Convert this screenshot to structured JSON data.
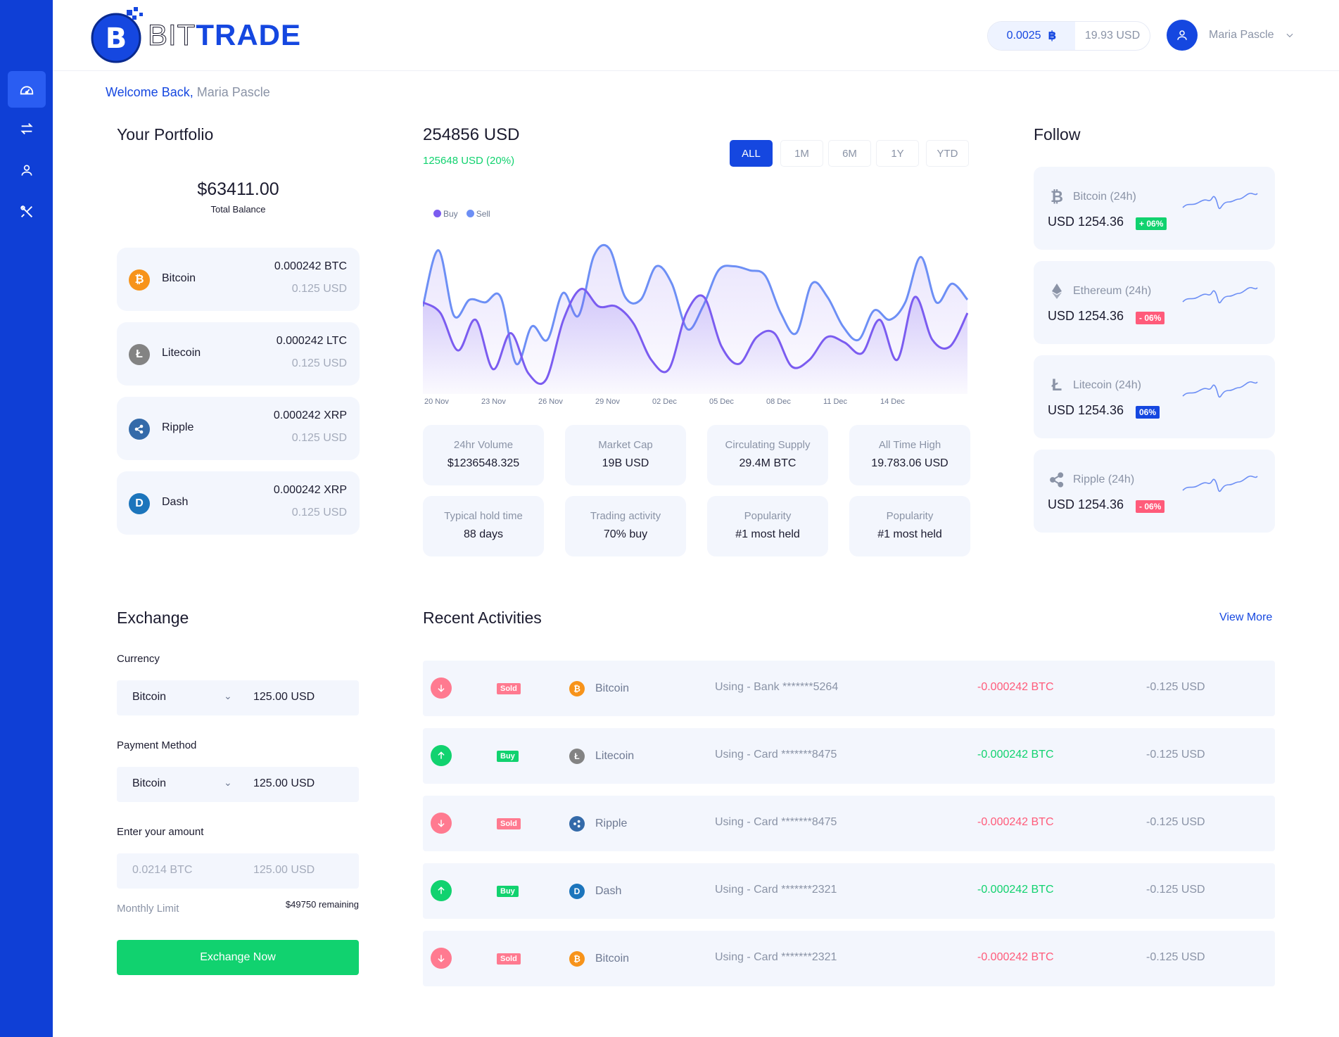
{
  "brand": {
    "logo_text_a": "BIT",
    "logo_text_b": "TRADE"
  },
  "header": {
    "btc_balance": "0.0025",
    "usd_balance": "19.93 USD",
    "user_name": "Maria Pascle"
  },
  "welcome": {
    "greeting": "Welcome Back,",
    "name": "Maria Pascle"
  },
  "portfolio": {
    "title": "Your Portfolio",
    "total_amount": "$63411.00",
    "total_label": "Total Balance",
    "coins": [
      {
        "name": "Bitcoin",
        "amount": "0.000242 BTC",
        "usd": "0.125 USD",
        "icon": "bitcoin-icon",
        "color": "#f7931a"
      },
      {
        "name": "Litecoin",
        "amount": "0.000242 LTC",
        "usd": "0.125 USD",
        "icon": "litecoin-icon",
        "color": "#838383"
      },
      {
        "name": "Ripple",
        "amount": "0.000242 XRP",
        "usd": "0.125 USD",
        "icon": "ripple-icon",
        "color": "#346aa9"
      },
      {
        "name": "Dash",
        "amount": "0.000242 XRP",
        "usd": "0.125 USD",
        "icon": "dash-icon",
        "color": "#1c75bc"
      }
    ]
  },
  "price": {
    "main": "254856 USD",
    "change": "125648 USD (20%)",
    "ranges": [
      "ALL",
      "1M",
      "6M",
      "1Y",
      "YTD"
    ],
    "active_range": "ALL"
  },
  "chart_data": {
    "type": "area",
    "x": [
      "20 Nov",
      "23 Nov",
      "26 Nov",
      "29 Nov",
      "02 Dec",
      "05 Dec",
      "08 Dec",
      "11 Dec",
      "14 Dec"
    ],
    "legend": [
      "Buy",
      "Sell"
    ],
    "colors": {
      "buy": "#7b5cf0",
      "sell": "#6d8ff5"
    },
    "series": [
      {
        "name": "Sell",
        "values": [
          0.55,
          0.97,
          0.48,
          0.6,
          0.58,
          0.62,
          0.12,
          0.4,
          0.3,
          0.65,
          0.48,
          0.93,
          0.98,
          0.62,
          0.6,
          0.85,
          0.72,
          0.38,
          0.55,
          0.82,
          0.85,
          0.82,
          0.78,
          0.5,
          0.35,
          0.72,
          0.62,
          0.4,
          0.3,
          0.52,
          0.45,
          0.58,
          0.92,
          0.58,
          0.72,
          0.6
        ]
      },
      {
        "name": "Buy",
        "values": [
          0.58,
          0.5,
          0.22,
          0.45,
          0.08,
          0.35,
          0.05,
          0.0,
          0.45,
          0.68,
          0.55,
          0.55,
          0.42,
          0.15,
          0.08,
          0.5,
          0.62,
          0.25,
          0.12,
          0.32,
          0.35,
          0.1,
          0.15,
          0.32,
          0.28,
          0.2,
          0.45,
          0.15,
          0.62,
          0.3,
          0.25,
          0.5
        ]
      }
    ]
  },
  "stats": [
    {
      "label": "24hr Volume",
      "value": "$1236548.325"
    },
    {
      "label": "Market Cap",
      "value": "19B USD"
    },
    {
      "label": "Circulating Supply",
      "value": "29.4M BTC"
    },
    {
      "label": "All Time High",
      "value": "19.783.06 USD"
    },
    {
      "label": "Typical hold time",
      "value": "88 days"
    },
    {
      "label": "Trading activity",
      "value": "70% buy"
    },
    {
      "label": "Popularity",
      "value": "#1 most held"
    },
    {
      "label": "Popularity",
      "value": "#1 most held"
    }
  ],
  "follow": {
    "title": "Follow",
    "items": [
      {
        "name": "Bitcoin (24h)",
        "price": "USD 1254.36",
        "badge": "+ 06%",
        "badge_color": "#11d26f",
        "icon": "bitcoin-icon"
      },
      {
        "name": "Ethereum (24h)",
        "price": "USD 1254.36",
        "badge": "- 06%",
        "badge_color": "#ff5b7a",
        "icon": "ethereum-icon"
      },
      {
        "name": "Litecoin (24h)",
        "price": "USD 1254.36",
        "badge": "06%",
        "badge_color": "#1547e0",
        "icon": "litecoin-icon"
      },
      {
        "name": "Ripple (24h)",
        "price": "USD 1254.36",
        "badge": "- 06%",
        "badge_color": "#ff5b7a",
        "icon": "ripple-icon"
      }
    ]
  },
  "exchange": {
    "title": "Exchange",
    "currency_label": "Currency",
    "currency_value": "Bitcoin",
    "currency_amount": "125.00 USD",
    "payment_label": "Payment Method",
    "payment_value": "Bitcoin",
    "payment_amount": "125.00 USD",
    "amount_label": "Enter your amount",
    "amount_btc_placeholder": "0.0214 BTC",
    "amount_usd_placeholder": "125.00 USD",
    "limit_label": "Monthly Limit",
    "limit_value": "$49750 remaining",
    "button": "Exchange Now"
  },
  "activities": {
    "title": "Recent Activities",
    "view_more": "View More",
    "rows": [
      {
        "type": "Sold",
        "coin": "Bitcoin",
        "icon": "bitcoin-icon",
        "coin_color": "#f7931a",
        "method": "Using - Bank *******5264",
        "btc": "-0.000242 BTC",
        "usd": "-0.125 USD"
      },
      {
        "type": "Buy",
        "coin": "Litecoin",
        "icon": "litecoin-icon",
        "coin_color": "#838383",
        "method": "Using - Card *******8475",
        "btc": "-0.000242 BTC",
        "usd": "-0.125 USD"
      },
      {
        "type": "Sold",
        "coin": "Ripple",
        "icon": "ripple-icon",
        "coin_color": "#346aa9",
        "method": "Using - Card *******8475",
        "btc": "-0.000242 BTC",
        "usd": "-0.125 USD"
      },
      {
        "type": "Buy",
        "coin": "Dash",
        "icon": "dash-icon",
        "coin_color": "#1c75bc",
        "method": "Using - Card *******2321",
        "btc": "-0.000242 BTC",
        "usd": "-0.125 USD"
      },
      {
        "type": "Sold",
        "coin": "Bitcoin",
        "icon": "bitcoin-icon",
        "coin_color": "#f7931a",
        "method": "Using - Card *******2321",
        "btc": "-0.000242 BTC",
        "usd": "-0.125 USD"
      }
    ]
  },
  "colors": {
    "primary": "#1547e0",
    "sidebar": "#0f3fd6",
    "success": "#11d26f",
    "danger": "#ff5b7a",
    "card": "#f3f6fd"
  }
}
